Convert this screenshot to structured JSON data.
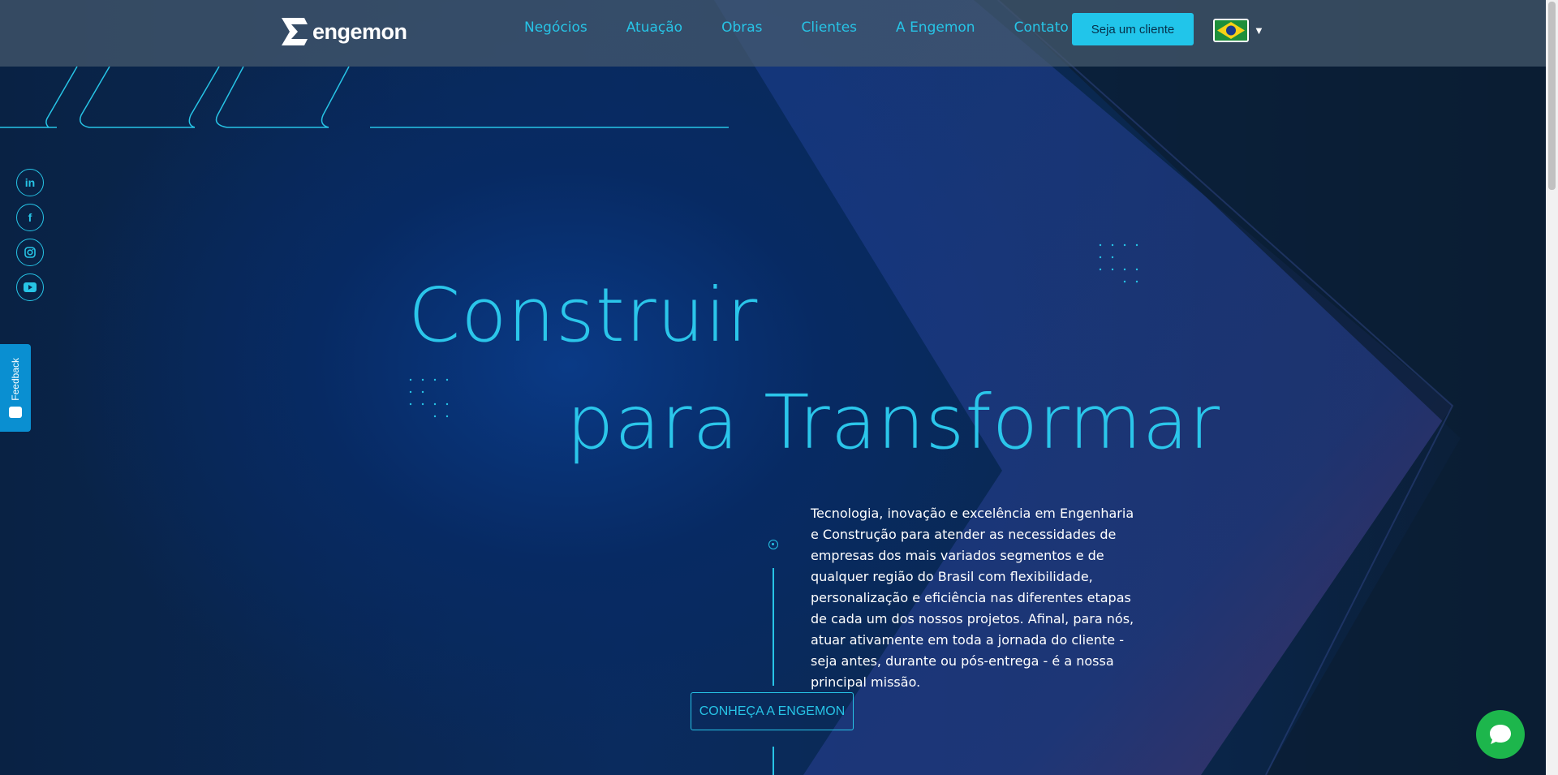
{
  "brand": {
    "name": "engemon"
  },
  "nav": {
    "items": [
      "Negócios",
      "Atuação",
      "Obras",
      "Clientes",
      "A Engemon",
      "Contato"
    ],
    "cta": "Seja um cliente",
    "language": "pt-BR"
  },
  "social": [
    "linkedin-icon",
    "facebook-icon",
    "instagram-icon",
    "youtube-icon"
  ],
  "feedback": {
    "label": "Feedback"
  },
  "hero": {
    "line1": "Construir",
    "line2": "para Transformar",
    "paragraph": "Tecnologia, inovação e excelência em Engenharia e Construção para atender as necessidades de empresas dos mais variados segmentos e de qualquer região do Brasil com flexibilidade, personalização e eficiência nas diferentes etapas de cada um dos nossos projetos. Afinal, para nós, atuar ativamente em toda a jornada do cliente - seja antes, durante ou pós-entrega - é a nossa principal missão.",
    "cta": "CONHEÇA A ENGEMON"
  },
  "colors": {
    "accent": "#27c4e6",
    "button": "#21c5ea",
    "chat": "#1db64c",
    "feedback": "#0a8fd1"
  }
}
